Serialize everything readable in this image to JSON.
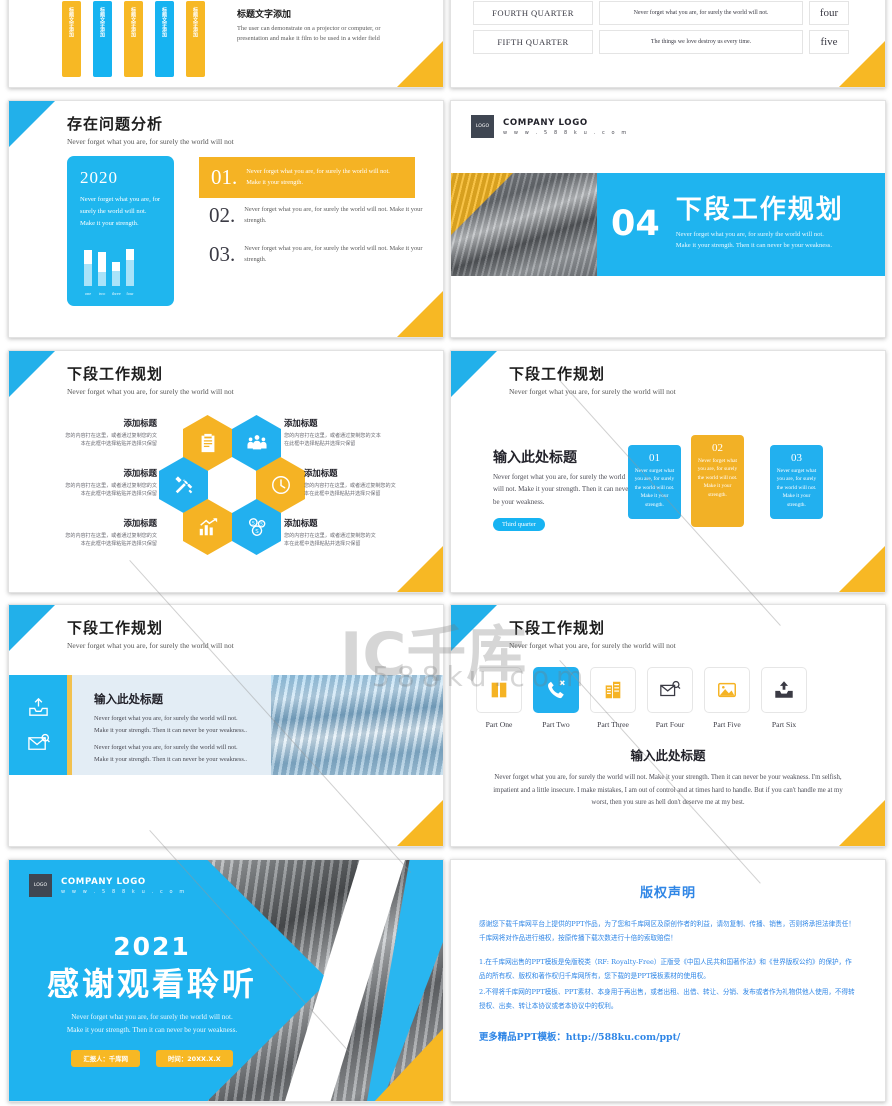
{
  "meta": {
    "accent_blue": "#1fb3ef",
    "accent_yellow": "#f7b824",
    "text_dark": "#23232b"
  },
  "watermark": {
    "mark": "IC千库",
    "sub": "588ku.com"
  },
  "slide_top_left": {
    "bars": [
      {
        "label": "标题文字添加",
        "color": "#f7b824"
      },
      {
        "label": "标题文字添加",
        "color": "#16b3f1"
      },
      {
        "label": "标题文字添加",
        "color": "#f7b824"
      },
      {
        "label": "标题文字添加",
        "color": "#16b3f1"
      },
      {
        "label": "标题文字添加",
        "color": "#f7b824"
      }
    ],
    "title": "标题文字添加",
    "body": "The user can demonstrate on a projector or computer, or presentation and make it film to be used in a wider field"
  },
  "slide_top_right": {
    "rows": [
      {
        "quarter": "FOURTH QUARTER",
        "text": "Never forget what you are, for surely the world will not.",
        "num": "four"
      },
      {
        "quarter": "FIFTH QUARTER",
        "text": "The things we love destroy us every time.",
        "num": "five"
      }
    ]
  },
  "slide_problems": {
    "title": "存在问题分析",
    "subtitle": "Never forget what you are, for surely the world will not",
    "card": {
      "year": "2020",
      "text": "Never forget what you are, for surely the world will not. Make it your strength.",
      "chart_labels": [
        "one",
        "two",
        "three",
        "four"
      ]
    },
    "items": [
      {
        "num": "01.",
        "text": "Never forget what you are, for surely the world will not. Make it your strength."
      },
      {
        "num": "02.",
        "text": "Never forget what you are, for surely the world will not. Make it your strength."
      },
      {
        "num": "03.",
        "text": "Never forget what you are, for surely the world will not. Make it your strength."
      }
    ]
  },
  "slide_section": {
    "logo_box": "LOGO",
    "logo_name": "COMPANY LOGO",
    "logo_url": "w w w . 5 8 8 k u . c o m",
    "number": "04",
    "title": "下段工作规划",
    "line1": "Never forget what you are, for surely the world will not.",
    "line2": "Make it your strength. Then it can never be your weakness."
  },
  "slide_hex": {
    "title": "下段工作规划",
    "subtitle": "Never forget what you are, for surely the world will not",
    "labels": [
      {
        "head": "添加标题",
        "body": "您的内容打在这里，或者通过复制您的文<br>本在此框中选择粘贴并选择只保留"
      },
      {
        "head": "添加标题",
        "body": "您的内容打在这里，或者通过复制您的文本<br>在此框中选择粘贴并选择只保留"
      },
      {
        "head": "添加标题",
        "body": "您的内容打在这里，或者通过复制您的文<br>本在此框中选择粘贴并选择只保留"
      },
      {
        "head": "添加标题",
        "body": "您的内容打在这里，或者通过复制您的文<br>本在此框中选择粘贴并选择只保留"
      },
      {
        "head": "添加标题",
        "body": "您的内容打在这里，或者通过复制您的文<br>本在此框中选择粘贴并选择只保留"
      },
      {
        "head": "添加标题",
        "body": "您的内容打在这里，或者通过复制您的文<br>本在此框中选择粘贴并选择只保留"
      }
    ],
    "icons": [
      "clipboard-icon",
      "users-icon",
      "tools-icon",
      "clock-icon",
      "chart-icon",
      "coins-icon"
    ]
  },
  "slide_cards": {
    "title": "下段工作规划",
    "subtitle": "Never forget what you are, for surely the world will not",
    "left_head": "输入此处标题",
    "left_body": "Never forget what you are, for surely the world will not. Make it your strength. Then it can never be your weakness.",
    "badge": "Third quarter",
    "cards": [
      {
        "num": "01",
        "text": "Never surget what you are, for surely the world will not. Make it your strength.",
        "color": "#22b0ef"
      },
      {
        "num": "02",
        "text": "Never forget what you are, for surely the world will not. Make it your strength.",
        "color": "#f2b126"
      },
      {
        "num": "03",
        "text": "Never surget what you are, for surely the world will not. Make it your strength.",
        "color": "#22b0ef"
      }
    ]
  },
  "slide_image": {
    "title": "下段工作规划",
    "subtitle": "Never forget what you are, for surely the world will not",
    "icons": [
      "inbox-upload-icon",
      "mail-search-icon"
    ],
    "head": "输入此处标题",
    "p1": "Never forget what you are, for surely the world will not. Make it your strength. Then it can never be your weakness..",
    "p2": "Never forget what you are, for surely the world will not. Make it your strength. Then it can never be your weakness.."
  },
  "slide_parts": {
    "title": "下段工作规划",
    "subtitle": "Never forget what you are, for surely the world will not",
    "parts": [
      {
        "caption": "Part One",
        "icon": "book-icon",
        "active": false
      },
      {
        "caption": "Part Two",
        "icon": "phone-missed-icon",
        "active": true
      },
      {
        "caption": "Part Three",
        "icon": "building-icon",
        "active": false
      },
      {
        "caption": "Part Four",
        "icon": "mail-search-icon",
        "active": false
      },
      {
        "caption": "Part Five",
        "icon": "image-icon",
        "active": false
      },
      {
        "caption": "Part Six",
        "icon": "upload-icon",
        "active": false
      }
    ],
    "head": "输入此处标题",
    "body": "Never forget what you are, for surely the world will not. Make it your strength. Then it can never be your weakness. I'm selfish, impatient and a little insecure. I make mistakes, I am out of control and at times hard to handle. But if you can't handle me at my worst, then you sure as hell don't deserve me at my best."
  },
  "slide_thanks": {
    "logo_box": "LOGO",
    "logo_name": "COMPANY LOGO",
    "logo_url": "w w w . 5 8 8 k u . c o m",
    "year": "2021",
    "title": "感谢观看聆听",
    "line1": "Never forget what you are, for surely the world will not.",
    "line2": "Make it your strength. Then it can never be your weakness.",
    "pill1": "汇报人：千库网",
    "pill2": "时间：20XX.X.X"
  },
  "slide_copyright": {
    "title": "版权声明",
    "p1": "感谢您下载千库网平台上提供的PPT作品，为了您和千库网区及原创作者的利益，请勿复制、传播、销售，否则将承担法律责任！千库网将对作品进行维权，按原传播下载次数进行十倍的索取赔偿！",
    "p2": "1.在千库网出售的PPT模板是免版税类（RF: Royalty-Free）正版受《中国人民共和国著作法》和《世界版权公约》的保护，作品的所有权、版权和著作权归千库网所有，您下载的是PPT模板素材的使用权。",
    "p3": "2.不得将千库网的PPT模板、PPT素材、本身用于再出售，或者出租、出借、转让、分销、发布或者作为礼物供他人使用，不得转授权、出卖、转让本协议或者本协议中的权利。",
    "more": "更多精品PPT模板：http://588ku.com/ppt/"
  }
}
